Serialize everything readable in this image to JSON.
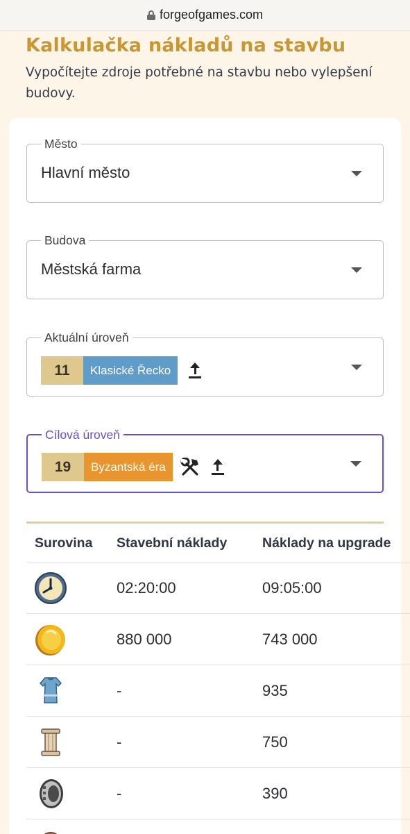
{
  "browser": {
    "url": "forgeofgames.com"
  },
  "header": {
    "title": "Kalkulačka nákladů na stavbu",
    "subtitle": "Vypočítejte zdroje potřebné na stavbu nebo vylepšení budovy."
  },
  "form": {
    "city": {
      "label": "Město",
      "value": "Hlavní město"
    },
    "building": {
      "label": "Budova",
      "value": "Městská farma"
    },
    "current_level": {
      "label": "Aktuální úroveň",
      "level": "11",
      "era": "Klasické Řecko",
      "era_color": "#5f9cc9"
    },
    "target_level": {
      "label": "Cílová úroveň",
      "level": "19",
      "era": "Byzantská éra",
      "era_color": "#e8942f"
    }
  },
  "table": {
    "headers": [
      "Surovina",
      "Stavební náklady",
      "Náklady na upgrade"
    ],
    "rows": [
      {
        "icon": "clock-icon",
        "build": "02:20:00",
        "upgrade": "09:05:00"
      },
      {
        "icon": "coin-icon",
        "build": "880 000",
        "upgrade": "743 000"
      },
      {
        "icon": "tunic-icon",
        "build": "-",
        "upgrade": "935"
      },
      {
        "icon": "column-icon",
        "build": "-",
        "upgrade": "750"
      },
      {
        "icon": "ring-icon",
        "build": "-",
        "upgrade": "390"
      },
      {
        "icon": "resource-icon",
        "build": "",
        "upgrade": ""
      }
    ]
  },
  "colors": {
    "title": "#c99634",
    "focus": "#6a4fd0",
    "level_badge": "#dfc88e"
  }
}
